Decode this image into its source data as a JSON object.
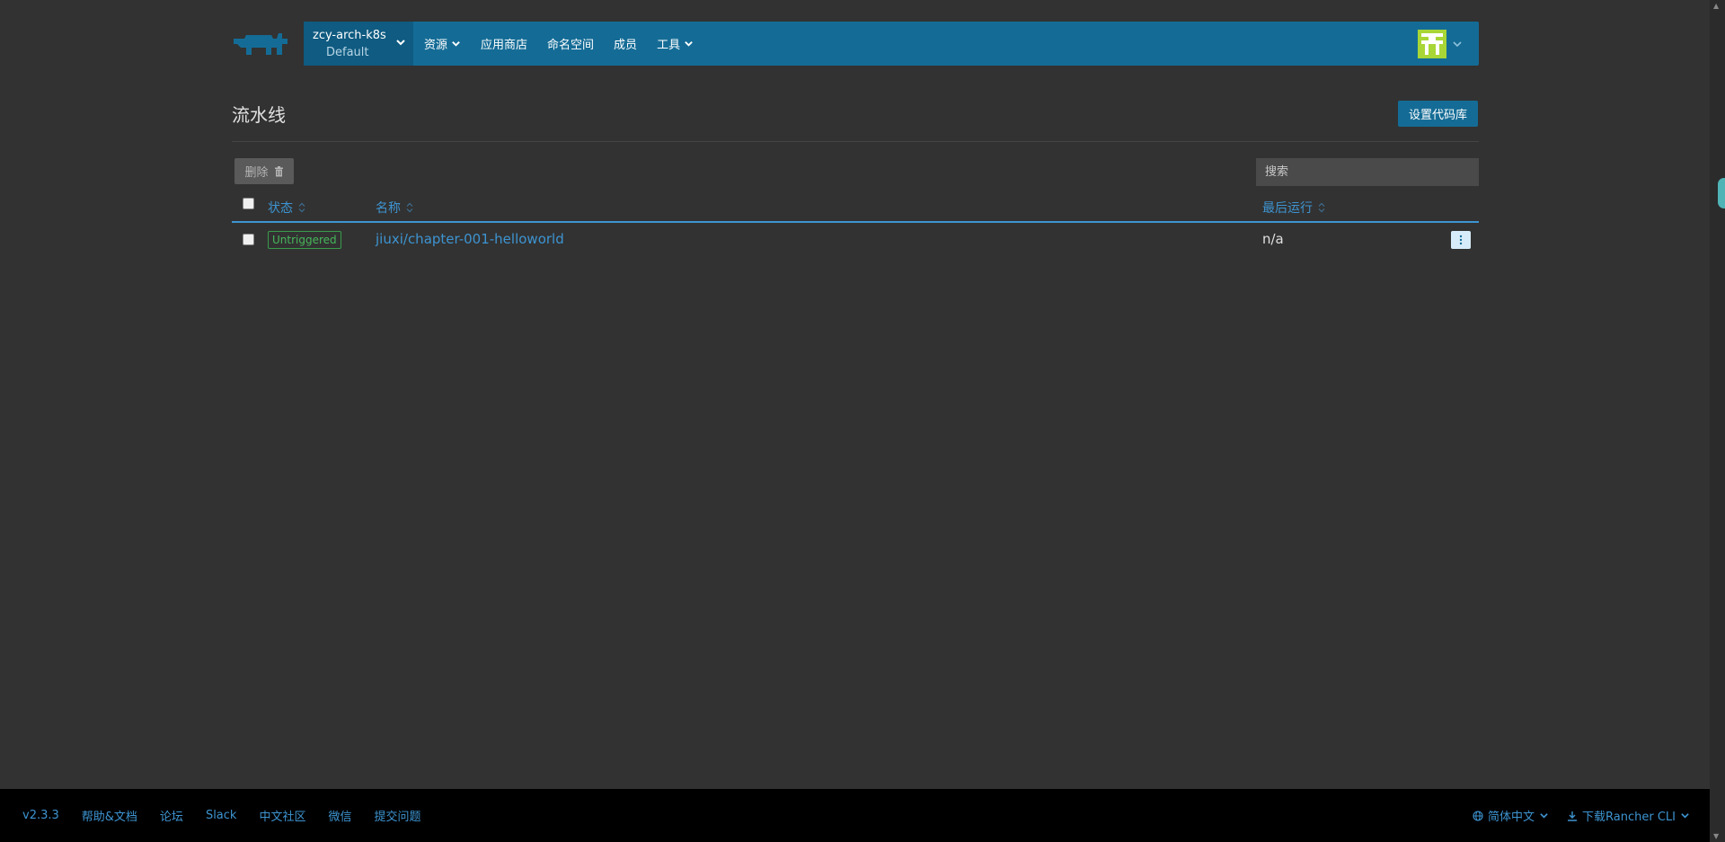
{
  "header": {
    "cluster_name": "zcy-arch-k8s",
    "project_name": "Default",
    "nav": [
      {
        "label": "资源"
      },
      {
        "label": "应用商店"
      },
      {
        "label": "命名空间"
      },
      {
        "label": "成员"
      },
      {
        "label": "工具"
      }
    ]
  },
  "page": {
    "title": "流水线",
    "setup_repo_label": "设置代码库"
  },
  "toolbar": {
    "delete_label": "删除",
    "search_placeholder": "搜索"
  },
  "table": {
    "columns": [
      {
        "label": "状态"
      },
      {
        "label": "名称"
      },
      {
        "label": "最后运行"
      }
    ],
    "rows": [
      {
        "status": "Untriggered",
        "name": "jiuxi/chapter-001-helloworld",
        "last_run": "n/a"
      }
    ]
  },
  "footer": {
    "links": [
      "v2.3.3",
      "帮助&文档",
      "论坛",
      "Slack",
      "中文社区",
      "微信",
      "提交问题"
    ],
    "language": "简体中文",
    "download": "下载Rancher CLI"
  },
  "colors": {
    "header_bg": "#146c96",
    "accent": "#3d94d1",
    "status_green": "#46b85a",
    "avatar_green": "#a8d636"
  }
}
